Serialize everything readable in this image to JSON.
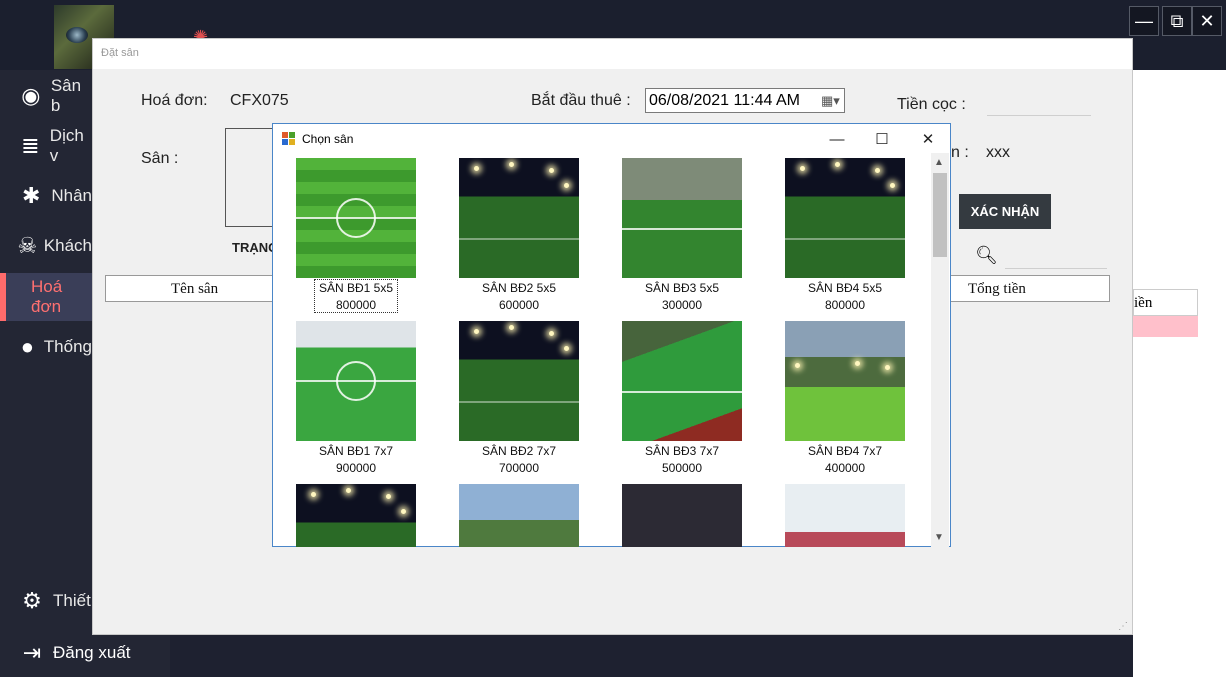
{
  "app": {
    "window_controls": {
      "minimize": "—",
      "maximize": "⧉",
      "close": "✕"
    }
  },
  "sidebar": {
    "items": [
      {
        "icon": "github-icon",
        "label": "Sân b"
      },
      {
        "icon": "stack-icon",
        "label": "Dịch v"
      },
      {
        "icon": "spider-icon",
        "label": "Nhân"
      },
      {
        "icon": "skull-icon",
        "label": "Khách"
      },
      {
        "icon": "none",
        "label": "Hoá đơn"
      },
      {
        "icon": "apple-icon",
        "label": "Thống"
      },
      {
        "icon": "gear-icon",
        "label": "Thiết"
      }
    ],
    "logout_label": "Đăng xuất",
    "active_index": 4,
    "active_color": "#ff6b6b"
  },
  "form": {
    "title": "Đặt sân",
    "invoice_label": "Hoá đơn:",
    "invoice_value": "CFX075",
    "start_label": "Bắt đầu thuê :",
    "start_value": "06/08/2021 11:44 AM",
    "deposit_label": "Tiền cọc :",
    "field_label": "Sân :",
    "status_label": "TRẠNG",
    "partial_label": "n :",
    "partial_value": "xxx",
    "confirm_button": "XÁC NHẬN",
    "columns": [
      "Tên sân",
      "Tổng tiền"
    ],
    "right_header": "iền"
  },
  "dialog": {
    "title": "Chọn sân",
    "controls": {
      "minimize": "—",
      "maximize": "☐",
      "close": "✕"
    },
    "selected_index": 0,
    "fields": [
      {
        "name": "SÂN BĐ1 5x5",
        "price": "800000",
        "img": "f-green"
      },
      {
        "name": "SÂN BĐ2 5x5",
        "price": "600000",
        "img": "f-night"
      },
      {
        "name": "SÂN BĐ3 5x5",
        "price": "300000",
        "img": "f-city"
      },
      {
        "name": "SÂN BĐ4 5x5",
        "price": "800000",
        "img": "f-night"
      },
      {
        "name": "SÂN BĐ1 7x7",
        "price": "900000",
        "img": "f-indoor"
      },
      {
        "name": "SÂN BĐ2 7x7",
        "price": "700000",
        "img": "f-night"
      },
      {
        "name": "SÂN BĐ3 7x7",
        "price": "500000",
        "img": "f-aerial"
      },
      {
        "name": "SÂN BĐ4 7x7",
        "price": "400000",
        "img": "f-mountain"
      },
      {
        "name": "",
        "price": "",
        "img": "f-night"
      },
      {
        "name": "",
        "price": "",
        "img": "f-trees"
      },
      {
        "name": "",
        "price": "",
        "img": "f-crowd"
      },
      {
        "name": "",
        "price": "",
        "img": "f-court"
      }
    ]
  }
}
